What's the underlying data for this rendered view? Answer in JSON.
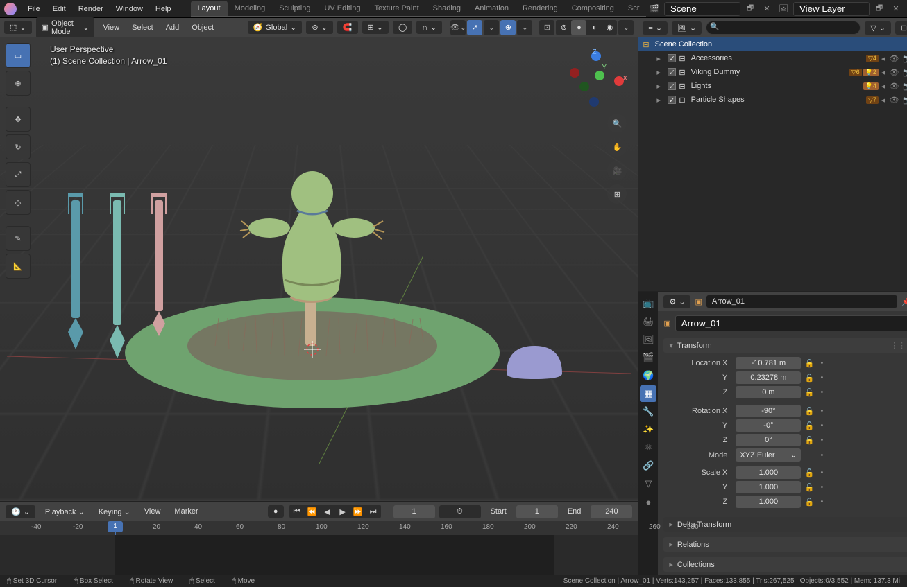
{
  "menu": {
    "file": "File",
    "edit": "Edit",
    "render": "Render",
    "window": "Window",
    "help": "Help"
  },
  "workspaces": [
    "Layout",
    "Modeling",
    "Sculpting",
    "UV Editing",
    "Texture Paint",
    "Shading",
    "Animation",
    "Rendering",
    "Compositing",
    "Scr"
  ],
  "workspace_active": "Layout",
  "scene_name": "Scene",
  "viewlayer_name": "View Layer",
  "viewport_header": {
    "mode": "Object Mode",
    "view": "View",
    "select": "Select",
    "add": "Add",
    "object": "Object",
    "orientation": "Global"
  },
  "viewport_info": {
    "perspective": "User Perspective",
    "collection": "(1) Scene Collection | Arrow_01"
  },
  "outliner": {
    "scene_collection": "Scene Collection",
    "items": [
      {
        "name": "Accessories",
        "badge": "4"
      },
      {
        "name": "Viking Dummy",
        "badge": "6",
        "badge2": "2"
      },
      {
        "name": "Lights",
        "badge": "4"
      },
      {
        "name": "Particle Shapes",
        "badge": "7"
      }
    ]
  },
  "properties": {
    "object_name": "Arrow_01",
    "name_field": "Arrow_01",
    "transform_header": "Transform",
    "location": {
      "label": "Location X",
      "x": "-10.781 m",
      "y": "0.23278 m",
      "z": "0 m"
    },
    "rotation": {
      "label": "Rotation X",
      "x": "-90°",
      "y": "-0°",
      "z": "0°"
    },
    "mode_label": "Mode",
    "mode_value": "XYZ Euler",
    "scale": {
      "label": "Scale X",
      "x": "1.000",
      "y": "1.000",
      "z": "1.000"
    },
    "delta": "Delta Transform",
    "relations": "Relations",
    "collections": "Collections"
  },
  "timeline": {
    "playback": "Playback",
    "keying": "Keying",
    "view": "View",
    "marker": "Marker",
    "current": "1",
    "start_label": "Start",
    "start": "1",
    "end_label": "End",
    "end": "240",
    "ticks": [
      "-40",
      "-20",
      "1",
      "20",
      "40",
      "60",
      "80",
      "100",
      "120",
      "140",
      "160",
      "180",
      "200",
      "220",
      "240",
      "260",
      "280"
    ]
  },
  "statusbar": {
    "items": [
      "Set 3D Cursor",
      "Box Select",
      "Rotate View",
      "Select",
      "Move"
    ],
    "right": "Scene Collection | Arrow_01 | Verts:143,257 | Faces:133,855 | Tris:267,525 | Objects:0/3,552 | Mem: 137.3 Mi"
  },
  "axis_labels": {
    "x": "X",
    "y": "Y",
    "z": "Z"
  },
  "single_chars": {
    "y": "Y",
    "z": "Z",
    "check": "✓",
    "dropdown": "⌄",
    "tri_right": "▸",
    "tri_down": "▾",
    "pin": "📌"
  }
}
